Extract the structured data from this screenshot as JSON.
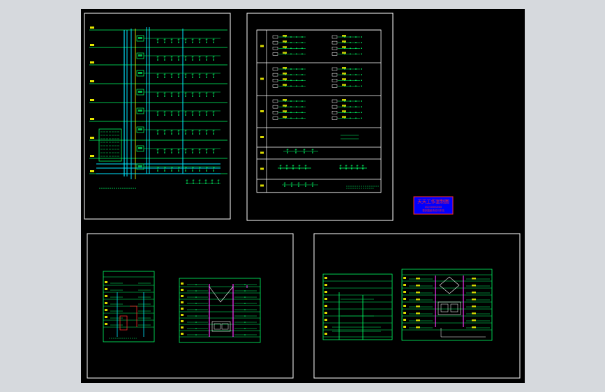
{
  "viewport": {
    "background": "#000000",
    "outer_background": "#d6d9dd"
  },
  "colors": {
    "frame": "#ffffff",
    "wire": "#00ff66",
    "bus": "#00e5ff",
    "riser": "#ff33ff",
    "accent": "#ffff00",
    "stamp_bg": "#0000ff",
    "stamp_text": "#ff2a2a"
  },
  "sheets": [
    {
      "id": "riser-diagram-1",
      "type": "electrical riser diagram"
    },
    {
      "id": "distribution-system-diagram",
      "type": "distribution box system diagram"
    },
    {
      "id": "riser-diagram-2",
      "type": "riser diagram set"
    },
    {
      "id": "riser-diagram-3",
      "type": "riser diagram set"
    }
  ],
  "stamp": {
    "line1": "天天工作室制图",
    "line2": "QQ:00000000",
    "line3": "更多图纸请访问本站"
  }
}
